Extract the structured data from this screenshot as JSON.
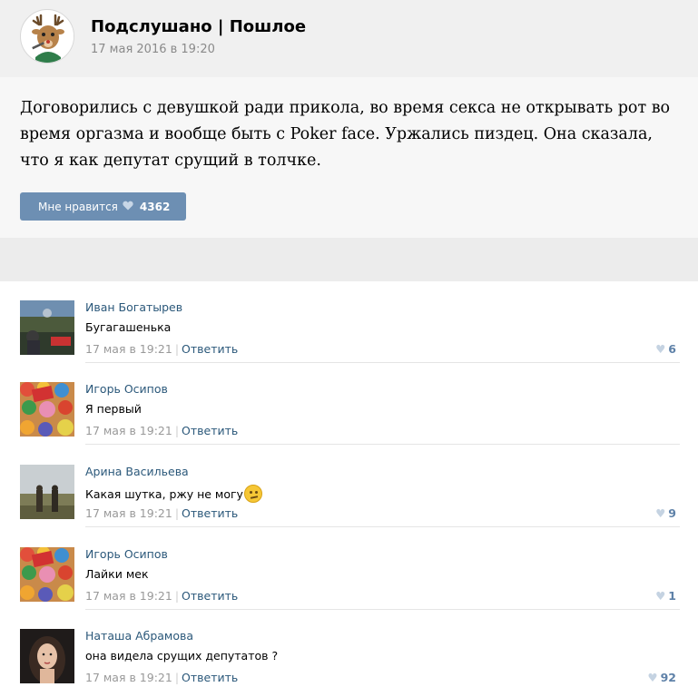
{
  "post": {
    "community_name": "Подслушано | Пошлое",
    "date": "17 мая 2016 в 19:20",
    "text": "Договорились с девушкой ради прикола, во время секса не открывать рот во время оргазма и вообще быть с Poker face. Уржались пиздец. Она сказала, что я как депутат срущий в толчке.",
    "like_label": "Мне нравится",
    "like_count": "4362",
    "like_icon": "heart-icon"
  },
  "comments": [
    {
      "author": "Иван Богатырев",
      "text": "Бугагашенька",
      "date": "17 мая в 19:21",
      "reply_label": "Ответить",
      "likes": "6"
    },
    {
      "author": "Игорь Осипов",
      "text": "Я первый",
      "date": "17 мая в 19:21",
      "reply_label": "Ответить",
      "likes": ""
    },
    {
      "author": "Арина Васильева",
      "text": "Какая шутка, ржу не могу",
      "date": "17 мая в 19:21",
      "reply_label": "Ответить",
      "likes": "9",
      "emoji": "confused-face-emoji"
    },
    {
      "author": "Игорь Осипов",
      "text": "Лайки мек",
      "date": "17 мая в 19:21",
      "reply_label": "Ответить",
      "likes": "1"
    },
    {
      "author": "Наташа Абрамова",
      "text": "она видела срущих депутатов ?",
      "date": "17 мая в 19:21",
      "reply_label": "Ответить",
      "likes": "92"
    }
  ],
  "colors": {
    "link": "#2b587a",
    "like_button": "#6d8fb3",
    "muted": "#999999"
  }
}
